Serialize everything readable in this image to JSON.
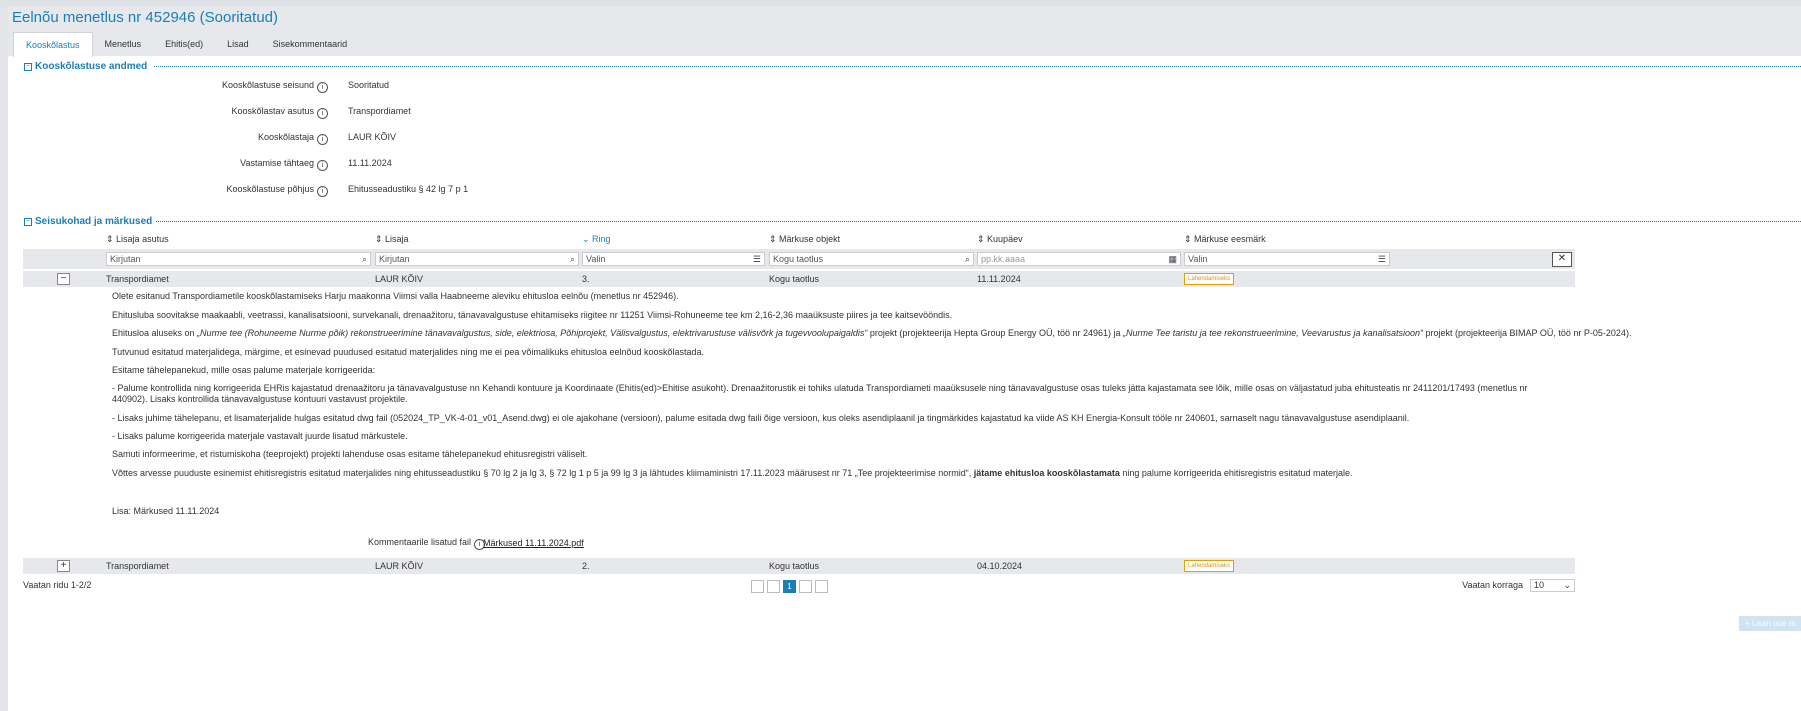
{
  "page": {
    "title": "Eelnõu menetlus nr 452946 (Sooritatud)"
  },
  "tabs": [
    {
      "label": "Kooskõlastus",
      "active": true
    },
    {
      "label": "Menetlus"
    },
    {
      "label": "Ehitis(ed)"
    },
    {
      "label": "Lisad"
    },
    {
      "label": "Sisekommentaarid"
    }
  ],
  "section1": {
    "title": "Kooskõlastuse andmed",
    "fields": [
      {
        "label": "Kooskõlastuse seisund",
        "value": "Sooritatud"
      },
      {
        "label": "Kooskõlastav asutus",
        "value": "Transpordiamet"
      },
      {
        "label": "Kooskõlastaja",
        "value": "LAUR KÕIV"
      },
      {
        "label": "Vastamise tähtaeg",
        "value": "11.11.2024"
      },
      {
        "label": "Kooskõlastuse põhjus",
        "value": "Ehitusseadustiku § 42 lg 7 p 1"
      }
    ]
  },
  "section2": {
    "title": "Seisukohad ja märkused",
    "columns": [
      "Lisaja asutus",
      "Lisaja",
      "Ring",
      "Märkuse objekt",
      "Kuupäev",
      "Märkuse eesmärk"
    ],
    "filters": {
      "f1": "Kirjutan",
      "f2": "Kirjutan",
      "f3": "Valin",
      "f4": "Kogu taotlus",
      "f5": "pp.kk.aaaa",
      "f6": "Valin"
    },
    "rows": [
      {
        "asutus": "Transpordiamet",
        "lisaja": "LAUR KÕIV",
        "ring": "3.",
        "objekt": "Kogu taotlus",
        "kuupaev": "11.11.2024",
        "eesmark": "Lahendamiseks"
      },
      {
        "asutus": "Transpordiamet",
        "lisaja": "LAUR KÕIV",
        "ring": "2.",
        "objekt": "Kogu taotlus",
        "kuupaev": "04.10.2024",
        "eesmark": "Lahendamiseks"
      }
    ],
    "comment": {
      "p1": "Olete esitanud Transpordiametile kooskõlastamiseks Harju maakonna Viimsi valla Haabneeme aleviku ehitusloa eelnõu (menetlus nr 452946).",
      "p2": "Ehitusluba soovitakse maakaabli, veetrassi, kanalisatsiooni, survekanali, drenaažitoru, tänavavalgustuse ehitamiseks riigitee nr 11251 Viimsi-Rohuneeme tee km 2,16-2,36 maaüksuste piires ja tee kaitsevööndis.",
      "p3a": "Ehitusloa aluseks on ",
      "p3b": "„Nurme tee (Rohuneeme Nurme põik) rekonstrueerimine tänavavalgustus, side, elektriosa, Põhiprojekt, Välisvalgustus, elektrivarustuse välisvõrk ja tugevvoolupaigaldis“",
      "p3c": " projekt (projekteerija Hepta Group Energy OÜ, töö nr 24961) ja ",
      "p3d": "„Nurme Tee taristu ja tee rekonstrueerimine, Veevarustus ja kanalisatsioon“",
      "p3e": " projekt (projekteerija BIMAP OÜ, töö nr P-05-2024).",
      "p4": "Tutvunud esitatud materjalidega, märgime, et esinevad puudused esitatud materjalides ning me ei pea võimalikuks ehitusloa eelnõud kooskõlastada.",
      "p5": "Esitame tähelepanekud, mille osas palume materjale korrigeerida:",
      "p6": "-  Palume kontrollida ning korrigeerida EHRis kajastatud drenaažitoru ja tänavavalgustuse nn Kehandi kontuure ja Koordinaate (Ehitis(ed)>Ehitise asukoht). Drenaažitorustik ei tohiks ulatuda Transpordiameti maaüksusele ning tänavavalgustuse osas tuleks jätta kajastamata see lõik, mille osas on väljastatud juba ehitusteatis nr 2411201/17493 (menetlus nr 440902). Lisaks kontrollida tänavavalgustuse kontuuri vastavust projektile.",
      "p7": "-  Lisaks juhime tähelepanu, et lisamaterjalide hulgas esitatud dwg fail (052024_TP_VK-4-01_v01_Asend.dwg) ei ole ajakohane (versioon), palume esitada dwg faili õige versioon, kus oleks asendiplaanil ja tingmärkides kajastatud ka viide AS KH Energia-Konsult tööle nr 240601, sarnaselt nagu tänavavalgustuse asendiplaanil.",
      "p8": "-  Lisaks palume korrigeerida materjale vastavalt juurde lisatud märkustele.",
      "p9": "Samuti informeerime, et ristumiskoha (teeprojekt) projekti lahenduse osas esitame tähelepanekud ehitusregistri väliselt.",
      "p10a": "Võttes arvesse puuduste esinemist ehitisregistris esitatud materjalides ning ehitusseadustiku § 70 lg 2 ja lg 3, § 72 lg 1 p 5 ja 99 lg 3 ja lähtudes kliimaministri 17.11.2023 määrusest nr 71 „Tee projekteerimise normid“, ",
      "p10b": "jätame ehitusloa kooskõlastamata",
      "p10c": " ning palume korrigeerida ehitisregistris esitatud materjale.",
      "p11": "Lisa: Märkused 11.11.2024",
      "attach_label": "Kommentaarile lisatud fail",
      "attach_file": "Märkused 11.11.2024.pdf"
    },
    "footer": {
      "rows_info": "Vaatan ridu 1-2/2",
      "current_page": "1",
      "page_size_label": "Vaatan korraga",
      "page_size": "10"
    }
  },
  "add_button": "Lisan uue m",
  "colors": {
    "accent": "#1a7fb5",
    "badge": "#e6a000"
  }
}
